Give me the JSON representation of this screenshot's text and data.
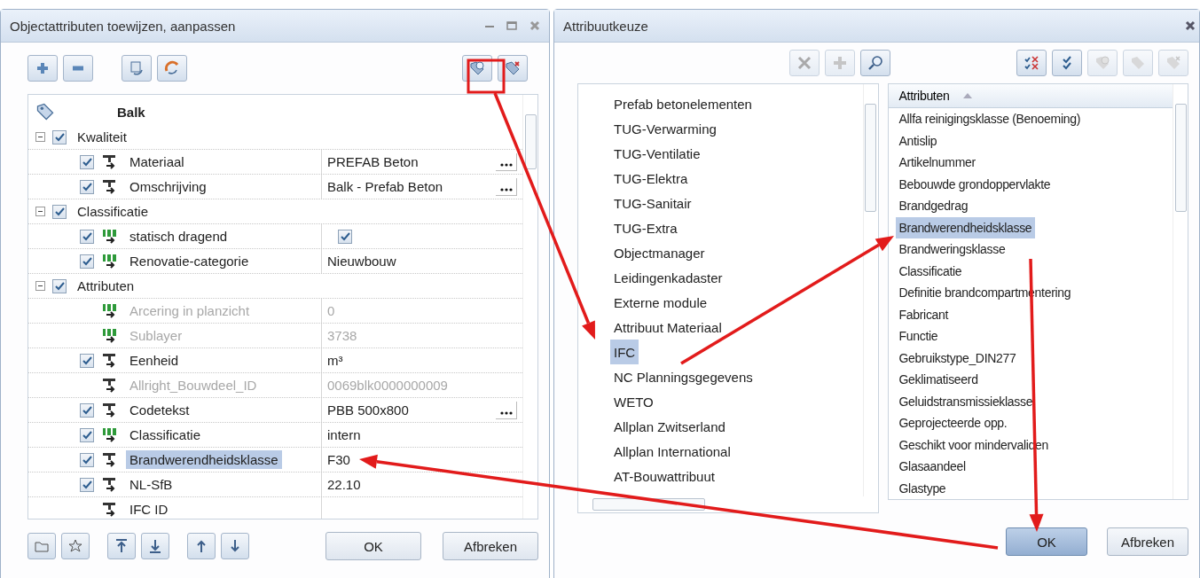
{
  "left_window": {
    "title": "Objectattributen toewijzen, aanpassen",
    "tree": {
      "root": "Balk",
      "children": [
        {
          "label": "Kwaliteit",
          "checked": true,
          "expanded": true,
          "children": [
            {
              "label": "Materiaal",
              "kind": "text",
              "checked": true,
              "value": "PREFAB Beton",
              "disabled": false,
              "browse": true,
              "selected": false
            },
            {
              "label": "Omschrijving",
              "kind": "text",
              "checked": true,
              "value": "Balk - Prefab Beton",
              "disabled": false,
              "browse": true,
              "selected": false
            }
          ]
        },
        {
          "label": "Classificatie",
          "checked": true,
          "expanded": true,
          "children": [
            {
              "label": "statisch dragend",
              "kind": "number",
              "checked": true,
              "value_checked": true,
              "disabled": false,
              "browse": false,
              "selected": false
            },
            {
              "label": "Renovatie-categorie",
              "kind": "number",
              "checked": true,
              "value": "Nieuwbouw",
              "disabled": false,
              "browse": false,
              "selected": false
            }
          ]
        },
        {
          "label": "Attributen",
          "checked": true,
          "expanded": true,
          "children": [
            {
              "label": "Arcering in planzicht",
              "kind": "number",
              "checked": false,
              "value": "0",
              "disabled": true,
              "browse": false,
              "selected": false
            },
            {
              "label": "Sublayer",
              "kind": "number",
              "checked": false,
              "value": "3738",
              "disabled": true,
              "browse": false,
              "selected": false
            },
            {
              "label": "Eenheid",
              "kind": "text",
              "checked": true,
              "value": "m³",
              "disabled": false,
              "browse": false,
              "selected": false
            },
            {
              "label": "Allright_Bouwdeel_ID",
              "kind": "text",
              "checked": false,
              "value": "0069blk0000000009",
              "disabled": true,
              "browse": false,
              "selected": false
            },
            {
              "label": "Codetekst",
              "kind": "text",
              "checked": true,
              "value": "PBB 500x800",
              "disabled": false,
              "browse": true,
              "selected": false
            },
            {
              "label": "Classificatie",
              "kind": "number",
              "checked": true,
              "value": "intern",
              "disabled": false,
              "browse": false,
              "selected": false
            },
            {
              "label": "Brandwerendheidsklasse",
              "kind": "text",
              "checked": true,
              "value": "F30",
              "disabled": false,
              "browse": false,
              "selected": true
            },
            {
              "label": "NL-SfB",
              "kind": "text",
              "checked": true,
              "value": "22.10",
              "disabled": false,
              "browse": false,
              "selected": false
            },
            {
              "label": "IFC ID",
              "kind": "text",
              "checked": false,
              "disabled": false,
              "browse": false,
              "selected": false
            }
          ]
        }
      ]
    },
    "buttons": [
      "OK",
      "Afbreken"
    ]
  },
  "right_window": {
    "title": "Attribuutkeuze",
    "toolbar": [
      {
        "kind": "excel",
        "disabled": true
      },
      {
        "kind": "add",
        "disabled": true
      },
      {
        "kind": "search",
        "disabled": false
      },
      {
        "kind": "uncheck-all",
        "disabled": false
      },
      {
        "kind": "check-all",
        "disabled": false
      },
      {
        "kind": "tag-add",
        "disabled": true
      },
      {
        "kind": "tag-edit",
        "disabled": true
      },
      {
        "kind": "tag-remove",
        "disabled": true
      }
    ],
    "categories": [
      {
        "label": "Prefab betonelementen",
        "selected": false
      },
      {
        "label": "TUG-Verwarming",
        "selected": false
      },
      {
        "label": "TUG-Ventilatie",
        "selected": false
      },
      {
        "label": "TUG-Elektra",
        "selected": false
      },
      {
        "label": "TUG-Sanitair",
        "selected": false
      },
      {
        "label": "TUG-Extra",
        "selected": false
      },
      {
        "label": "Objectmanager",
        "selected": false
      },
      {
        "label": "Leidingenkadaster",
        "selected": false
      },
      {
        "label": "Externe module",
        "selected": false
      },
      {
        "label": "Attribuut Materiaal",
        "selected": false
      },
      {
        "label": "IFC",
        "selected": true
      },
      {
        "label": "NC Planningsgegevens",
        "selected": false
      },
      {
        "label": "WETO",
        "selected": false
      },
      {
        "label": "Allplan Zwitserland",
        "selected": false
      },
      {
        "label": "Allplan International",
        "selected": false
      },
      {
        "label": "AT-Bouwattribuut",
        "selected": false
      }
    ],
    "attributes": {
      "header": "Attributen",
      "items": [
        {
          "label": "Allfa reinigingsklasse (Benoeming)",
          "selected": false
        },
        {
          "label": "Antislip",
          "selected": false
        },
        {
          "label": "Artikelnummer",
          "selected": false
        },
        {
          "label": "Bebouwde grondoppervlakte",
          "selected": false
        },
        {
          "label": "Brandgedrag",
          "selected": false
        },
        {
          "label": "Brandwerendheidsklasse",
          "selected": true
        },
        {
          "label": "Brandweringsklasse",
          "selected": false
        },
        {
          "label": "Classificatie",
          "selected": false
        },
        {
          "label": "Definitie brandcompartmentering",
          "selected": false
        },
        {
          "label": "Fabricant",
          "selected": false
        },
        {
          "label": "Functie",
          "selected": false
        },
        {
          "label": "Gebruikstype_DIN277",
          "selected": false
        },
        {
          "label": "Geklimatiseerd",
          "selected": false
        },
        {
          "label": "Geluidstransmissieklasse",
          "selected": false
        },
        {
          "label": "Geprojecteerde opp.",
          "selected": false
        },
        {
          "label": "Geschikt voor mindervaliden",
          "selected": false
        },
        {
          "label": "Glasaandeel",
          "selected": false
        },
        {
          "label": "Glastype",
          "selected": false
        }
      ]
    },
    "buttons": [
      {
        "label": "OK",
        "default": true
      },
      {
        "label": "Afbreken",
        "default": false
      }
    ]
  }
}
